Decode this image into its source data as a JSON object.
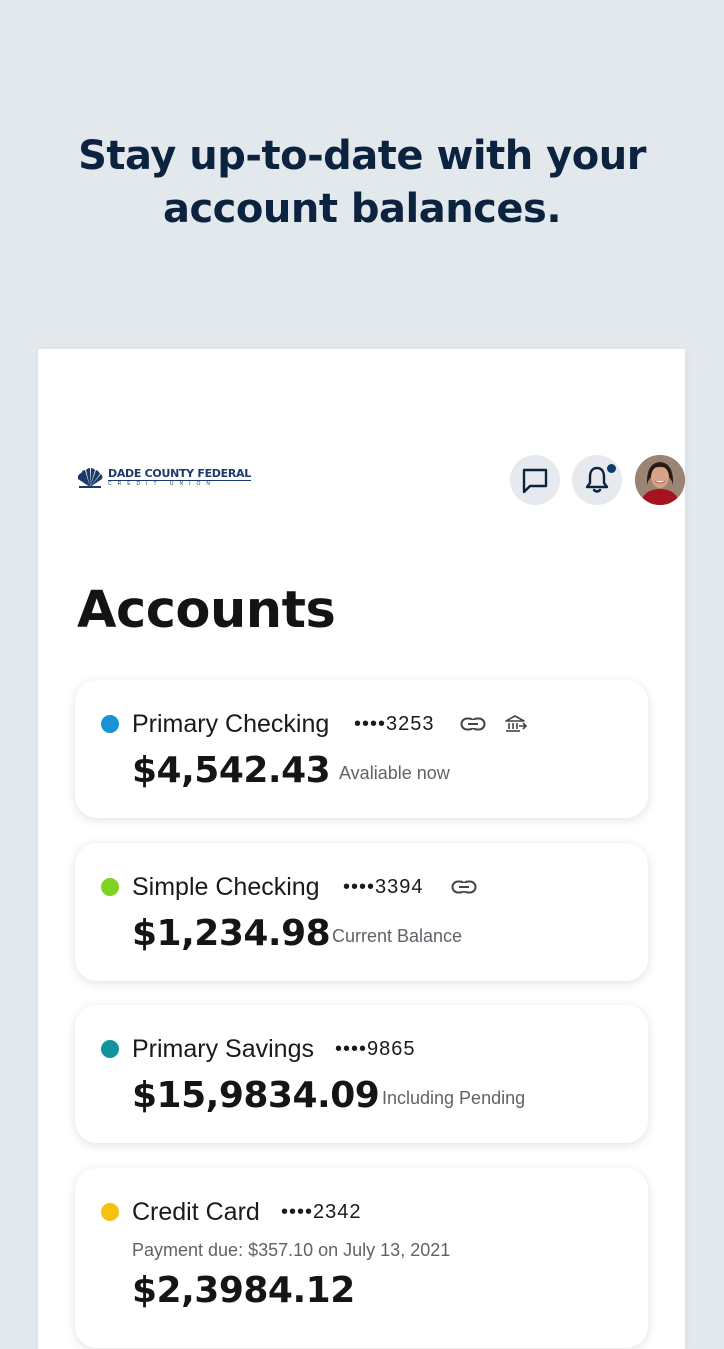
{
  "headline": {
    "line1": "Stay up-to-date with your",
    "line2": "account balances."
  },
  "header": {
    "logo_name": "DADE COUNTY FEDERAL",
    "logo_sub": "CREDIT UNION",
    "notification_badge": true
  },
  "page": {
    "title": "Accounts"
  },
  "accounts": [
    {
      "name": "Primary Checking",
      "mask": "••••3253",
      "amount": "$4,542.43",
      "subtitle": "Avaliable now",
      "dot_color": "#1a93d6",
      "icons": [
        "link-icon",
        "bank-transfer-icon"
      ]
    },
    {
      "name": "Simple Checking",
      "mask": "••••3394",
      "amount": "$1,234.98",
      "subtitle": "Current Balance",
      "dot_color": "#7ed321",
      "icons": [
        "link-icon"
      ]
    },
    {
      "name": "Primary Savings",
      "mask": "••••9865",
      "amount": "$15,9834.09",
      "subtitle": "Including Pending",
      "dot_color": "#14939b",
      "icons": []
    },
    {
      "name": "Credit Card",
      "mask": "••••2342",
      "payment_due": "Payment due: $357.10 on July 13, 2021",
      "amount": "$2,3984.12",
      "dot_color": "#f5c211",
      "icons": []
    }
  ],
  "colors": {
    "background": "#e3e8ed",
    "headline": "#0c2340",
    "brand": "#1b3a6b"
  }
}
